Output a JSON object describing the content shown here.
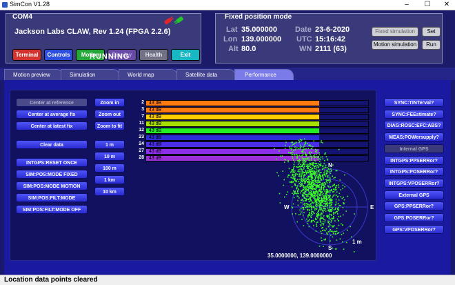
{
  "window": {
    "title": "SimCon V1.28",
    "min": "–",
    "max": "☐",
    "close": "✕"
  },
  "com": {
    "label": "COM4",
    "device": "Jackson Labs CLAW, Rev 1.24 (FPGA 2.2.6)",
    "buttons": [
      "Terminal",
      "Controls",
      "Motion",
      "Display",
      "Health",
      "Exit"
    ],
    "state": "RUNNING"
  },
  "fix": {
    "label": "Fixed position mode",
    "lat_label": "Lat",
    "lat": "35.000000",
    "lon_label": "Lon",
    "lon": "139.000000",
    "alt_label": "Alt",
    "alt": "80.0",
    "date_label": "Date",
    "date": "23-6-2020",
    "utc_label": "UTC",
    "utc": "15:16:42",
    "wn_label": "WN",
    "wn": "2111 (63)",
    "btn_fixed": "Fixed simulation",
    "btn_set": "Set",
    "btn_motion": "Motion simulation",
    "btn_run": "Run"
  },
  "tabs": [
    "Motion preview",
    "Simulation",
    "World map",
    "Satellite data",
    "Performance"
  ],
  "active_tab": "Performance",
  "left_buttons": {
    "center_ref": "Center at reference",
    "center_avg": "Center at average fix",
    "center_latest": "Center at latest fix",
    "clear": "Clear data",
    "intgps_reset": "INTGPS:RESET ONCE",
    "pos_fixed": "SIM:POS:MODE FIXED",
    "pos_motion": "SIM:POS:MODE MOTION",
    "filt_dynamic": "SIM:POS:FILT:MODE DYNAMIC",
    "filt_off": "SIM:POS:FILT:MODE OFF"
  },
  "zoom_buttons": {
    "zoom_in": "Zoom in",
    "zoom_out": "Zoom out",
    "zoom_fit": "Zoom to fit"
  },
  "scale_buttons": [
    "1 m",
    "10 m",
    "100 m",
    "1 km",
    "10 km"
  ],
  "satellites": [
    {
      "prn": "2",
      "label": "43 dB",
      "color": "#ff7a10"
    },
    {
      "prn": "3",
      "label": "43 dB",
      "color": "#ff7a10"
    },
    {
      "prn": "7",
      "label": "43 dB",
      "color": "#ffd000"
    },
    {
      "prn": "11",
      "label": "43 dB",
      "color": "#a8e000"
    },
    {
      "prn": "12",
      "label": "43 dB",
      "color": "#22ee22"
    },
    {
      "prn": "23",
      "label": "43 dB",
      "color": "#2b2bd8"
    },
    {
      "prn": "24",
      "label": "43 dB",
      "color": "#4b2ee8"
    },
    {
      "prn": "27",
      "label": "43 dB",
      "color": "#8d2ee8"
    },
    {
      "prn": "28",
      "label": "43 dB",
      "color": "#9a2ed8"
    }
  ],
  "compass": {
    "n": "N",
    "e": "E",
    "s": "S",
    "w": "W",
    "scale": "1 m"
  },
  "coordinate_readout": "35.0000000, 139.0000000",
  "right_buttons": [
    {
      "label": "SYNC:TINTerval?",
      "dim": false
    },
    {
      "label": "SYNC:FEEstimate?",
      "dim": false
    },
    {
      "label": "DIAG:ROSC:EFC:ABS?",
      "dim": false
    },
    {
      "label": "MEAS:POWersupply?",
      "dim": false
    },
    {
      "label": "Internal GPS",
      "dim": true
    },
    {
      "label": "INTGPS:PPSERRor?",
      "dim": false
    },
    {
      "label": "INTGPS:POSERRor?",
      "dim": false
    },
    {
      "label": "INTGPS:VPOSERRor?",
      "dim": false
    },
    {
      "label": "External GPS",
      "dim": false
    },
    {
      "label": "GPS:PPSERRor?",
      "dim": false
    },
    {
      "label": "GPS:POSERRor?",
      "dim": false
    },
    {
      "label": "GPS:VPOSERRor?",
      "dim": false
    }
  ],
  "status": "Location data points cleared"
}
